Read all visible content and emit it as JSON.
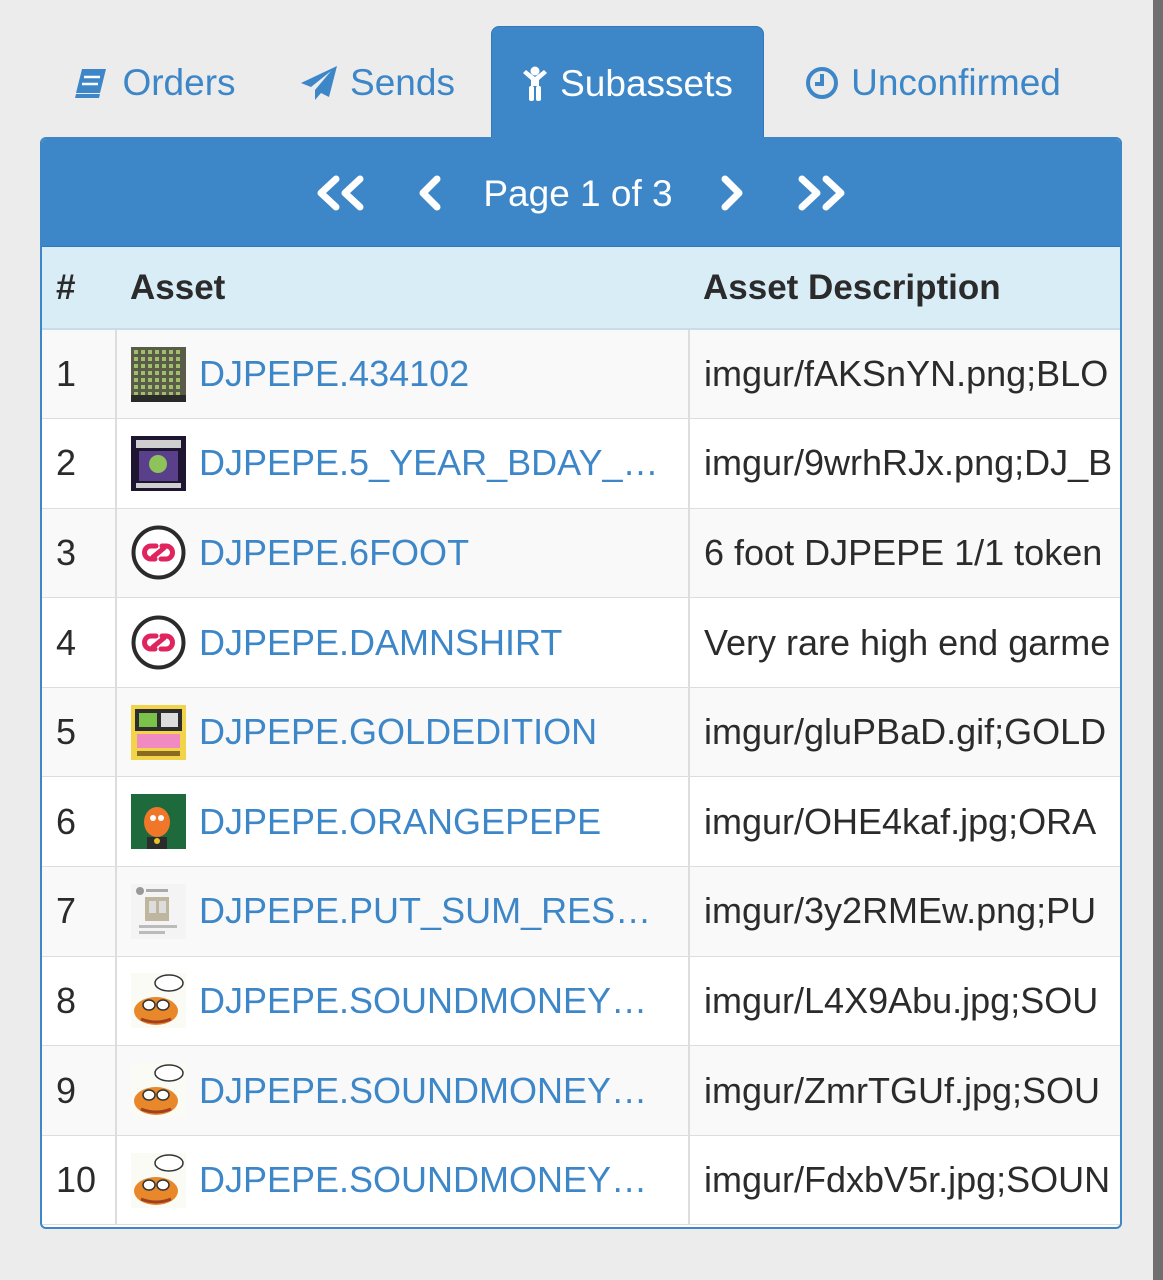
{
  "tabs": [
    {
      "label": "Orders",
      "icon": "book-icon"
    },
    {
      "label": "Sends",
      "icon": "paper-plane-icon"
    },
    {
      "label": "Subassets",
      "icon": "child-icon",
      "active": true
    },
    {
      "label": "Unconfirmed",
      "icon": "clock-icon"
    }
  ],
  "pager": {
    "text": "Page 1 of 3"
  },
  "table": {
    "headers": [
      "#",
      "Asset",
      "Asset Description"
    ],
    "rows": [
      {
        "num": "1",
        "asset": "DJPEPE.434102",
        "desc": "imgur/fAKSnYN.png;BLO",
        "thumb": "grid-art-thumbnail"
      },
      {
        "num": "2",
        "asset": "DJPEPE.5_YEAR_BDAY_…",
        "desc": "imgur/9wrhRJx.png;DJ_B",
        "thumb": "poster-art-thumbnail"
      },
      {
        "num": "3",
        "asset": "DJPEPE.6FOOT",
        "desc": "6 foot DJPEPE 1/1 token",
        "thumb": "chain-logo-icon"
      },
      {
        "num": "4",
        "asset": "DJPEPE.DAMNSHIRT",
        "desc": "Very rare high end garme",
        "thumb": "chain-logo-icon"
      },
      {
        "num": "5",
        "asset": "DJPEPE.GOLDEDITION",
        "desc": "imgur/gluPBaD.gif;GOLD",
        "thumb": "gold-card-thumbnail"
      },
      {
        "num": "6",
        "asset": "DJPEPE.ORANGEPEPE",
        "desc": "imgur/OHE4kaf.jpg;ORA",
        "thumb": "orange-pepe-thumbnail"
      },
      {
        "num": "7",
        "asset": "DJPEPE.PUT_SUM_RES…",
        "desc": "imgur/3y2RMEw.png;PU",
        "thumb": "tweet-screenshot-thumbnail"
      },
      {
        "num": "8",
        "asset": "DJPEPE.SOUNDMONEY…",
        "desc": "imgur/L4X9Abu.jpg;SOU",
        "thumb": "pepe-drawing-thumbnail"
      },
      {
        "num": "9",
        "asset": "DJPEPE.SOUNDMONEY…",
        "desc": "imgur/ZmrTGUf.jpg;SOU",
        "thumb": "pepe-drawing-thumbnail"
      },
      {
        "num": "10",
        "asset": "DJPEPE.SOUNDMONEY…",
        "desc": "imgur/FdxbV5r.jpg;SOUN",
        "thumb": "pepe-drawing-thumbnail"
      }
    ]
  },
  "colors": {
    "accent": "#3d87c8",
    "header_bg": "#d9edf7",
    "link": "#3d87c8"
  }
}
